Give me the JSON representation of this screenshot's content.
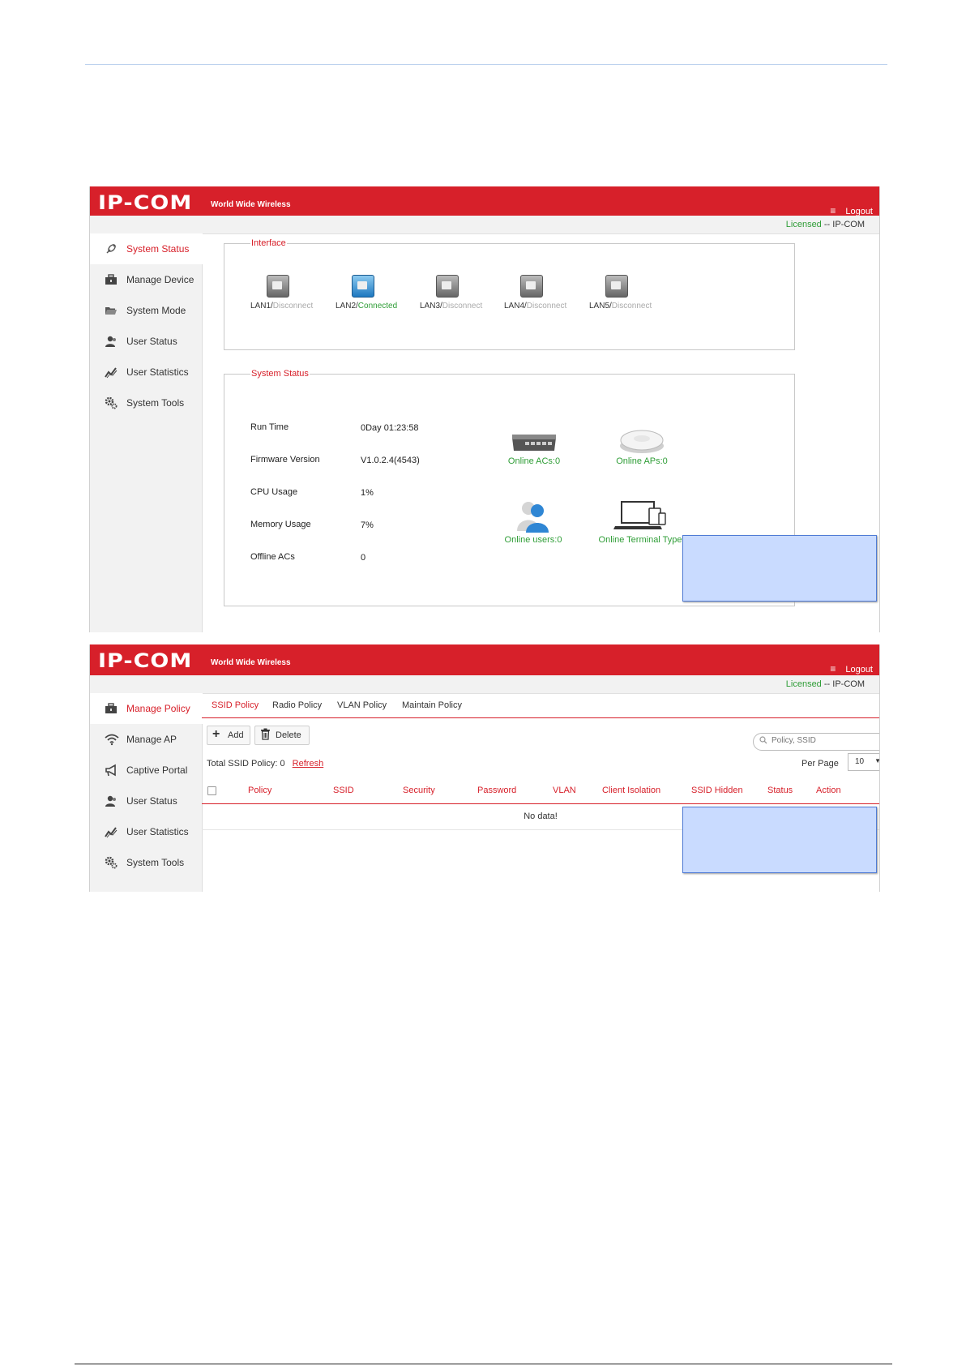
{
  "brand": {
    "logo": "IP-COM",
    "tagline": "World Wide Wireless",
    "logout": "Logout",
    "menu_icon": "≡",
    "accent": "#d7202a",
    "green": "#2e9d36"
  },
  "license": {
    "status": "Licensed",
    "separator": " -- ",
    "vendor": "IP-COM"
  },
  "screen1": {
    "nav": [
      {
        "label": "System Status",
        "icon": "satellite-icon",
        "active": true
      },
      {
        "label": "Manage Device",
        "icon": "toolbox-icon"
      },
      {
        "label": "System Mode",
        "icon": "folder-icon"
      },
      {
        "label": "User Status",
        "icon": "users-icon"
      },
      {
        "label": "User Statistics",
        "icon": "chart-icon"
      },
      {
        "label": "System Tools",
        "icon": "gears-icon"
      }
    ],
    "interface": {
      "legend": "Interface",
      "ports": [
        {
          "name": "LAN1/",
          "status": "Disconnect"
        },
        {
          "name": "LAN2/",
          "status": "Connected"
        },
        {
          "name": "LAN3/",
          "status": "Disconnect"
        },
        {
          "name": "LAN4/",
          "status": "Disconnect"
        },
        {
          "name": "LAN5/",
          "status": "Disconnect"
        }
      ]
    },
    "system_status": {
      "legend": "System Status",
      "rows": [
        {
          "label": "Run Time",
          "value": "0Day 01:23:58"
        },
        {
          "label": "Firmware Version",
          "value": "V1.0.2.4(4543)"
        },
        {
          "label": "CPU Usage",
          "value": "1%"
        },
        {
          "label": "Memory Usage",
          "value": "7%"
        },
        {
          "label": "Offline ACs",
          "value": "0"
        }
      ],
      "devices": [
        {
          "label": "Online ACs:0",
          "icon": "switch-icon"
        },
        {
          "label": "Online APs:0",
          "icon": "access-point-icon"
        },
        {
          "label": "Online users:0",
          "icon": "users-icon"
        },
        {
          "label": "Online Terminal Type",
          "icon": "devices-icon"
        }
      ]
    }
  },
  "screen2": {
    "nav": [
      {
        "label": "Manage Policy",
        "icon": "toolbox-icon",
        "active": true
      },
      {
        "label": "Manage AP",
        "icon": "wifi-icon"
      },
      {
        "label": "Captive Portal",
        "icon": "megaphone-icon"
      },
      {
        "label": "User Status",
        "icon": "users-icon"
      },
      {
        "label": "User Statistics",
        "icon": "chart-icon"
      },
      {
        "label": "System Tools",
        "icon": "gears-icon"
      }
    ],
    "tabs": [
      "SSID Policy",
      "Radio Policy",
      "VLAN Policy",
      "Maintain Policy"
    ],
    "toolbar": {
      "add": "Add",
      "delete": "Delete",
      "search_placeholder": "Policy, SSID"
    },
    "summary": {
      "total_label": "Total SSID Policy:",
      "total_value": "0",
      "refresh": "Refresh"
    },
    "per_page": {
      "label": "Per Page",
      "value": "10"
    },
    "columns": [
      "Policy",
      "SSID",
      "Security",
      "Password",
      "VLAN",
      "Client Isolation",
      "SSID Hidden",
      "Status",
      "Action"
    ],
    "empty_text": "No data!"
  }
}
